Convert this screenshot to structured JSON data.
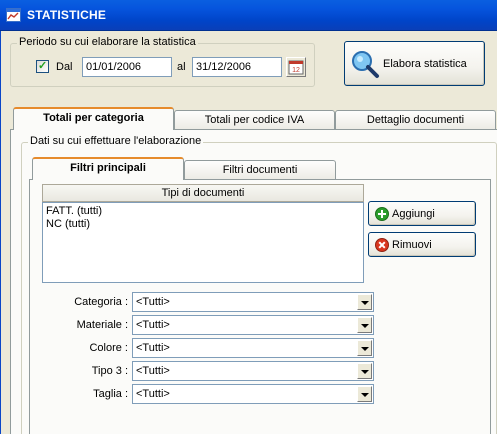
{
  "window": {
    "title": "STATISTICHE"
  },
  "periodo": {
    "legend": "Periodo su cui elaborare la statistica",
    "dal_label": "Dal",
    "dal_checked": true,
    "dal_value": "01/01/2006",
    "al_label": "al",
    "al_value": "31/12/2006",
    "calendar_day": "12"
  },
  "elabora_button": {
    "label": "Elabora statistica"
  },
  "main_tabs": [
    {
      "label": "Totali per categoria",
      "active": true
    },
    {
      "label": "Totali per codice IVA",
      "active": false
    },
    {
      "label": "Dettaglio documenti",
      "active": false
    }
  ],
  "dati": {
    "legend": "Dati su cui effettuare l'elaborazione"
  },
  "sub_tabs": [
    {
      "label": "Filtri principali",
      "active": true
    },
    {
      "label": "Filtri documenti",
      "active": false
    }
  ],
  "tipi_documenti": {
    "header": "Tipi di documenti",
    "items": [
      "FATT. (tutti)",
      "NC (tutti)"
    ]
  },
  "buttons": {
    "aggiungi": "Aggiungi",
    "rimuovi": "Rimuovi"
  },
  "filters": [
    {
      "label": "Categoria :",
      "value": "<Tutti>"
    },
    {
      "label": "Materiale :",
      "value": "<Tutti>"
    },
    {
      "label": "Colore :",
      "value": "<Tutti>"
    },
    {
      "label": "Tipo 3 :",
      "value": "<Tutti>"
    },
    {
      "label": "Taglia :",
      "value": "<Tutti>"
    }
  ],
  "colors": {
    "titlebar": "#0054e3",
    "accent_tab": "#e68b2c",
    "add_green": "#2a9d2a",
    "remove_red": "#d9361f"
  },
  "icons": {
    "app": "chart-window-icon",
    "calendar": "calendar-icon",
    "elabora": "magnifier-globe-icon",
    "add": "plus-circle-icon",
    "remove": "x-circle-icon"
  }
}
